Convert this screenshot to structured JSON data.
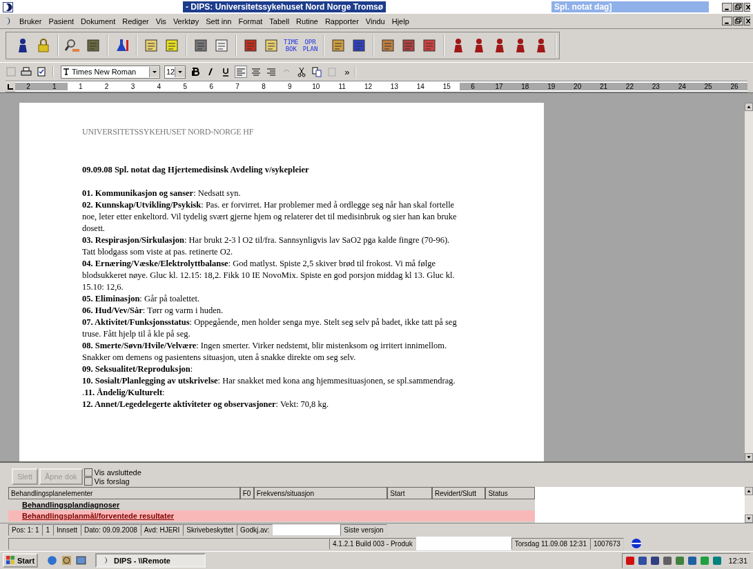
{
  "title_bar": {
    "title": "- DIPS: Universitetssykehuset Nord Norge Tromsø",
    "document_title": "Spl. notat dag]"
  },
  "menu": [
    "Bruker",
    "Pasient",
    "Dokument",
    "Rediger",
    "Vis",
    "Verktøy",
    "Sett inn",
    "Format",
    "Tabell",
    "Rutine",
    "Rapporter",
    "Vindu",
    "Hjelp"
  ],
  "toolbar": {
    "text_buttons": [
      {
        "lines": [
          "TIME",
          "BOK"
        ]
      },
      {
        "lines": [
          "OPR",
          "PLAN"
        ]
      }
    ]
  },
  "format_bar": {
    "font": "Times New Roman",
    "size": "12",
    "more": "»"
  },
  "ruler": {
    "labels": [
      "2",
      "1",
      "1",
      "2",
      "3",
      "4",
      "5",
      "6",
      "7",
      "8",
      "9",
      "10",
      "11",
      "12",
      "13",
      "14",
      "15",
      "6",
      "17",
      "18",
      "19",
      "20",
      "21",
      "22",
      "23",
      "24",
      "25",
      "26"
    ]
  },
  "document": {
    "header": "UNIVERSITETSSYKEHUSET NORD-NORGE HF",
    "title": "09.09.08 Spl. notat dag Hjertemedisinsk Avdeling v/sykepleier",
    "paragraphs": [
      "**01. Kommunikasjon og sanser**: Nedsatt syn.",
      "**02. Kunnskap/Utvikling/Psykisk**: Pas. er forvirret. Har problemer med å ordlegge seg når han skal fortelle noe, leter etter enkeltord. Vil tydelig svært gjerne hjem og relaterer det til medisinbruk og sier han kan bruke dosett.",
      "**03. Respirasjon/Sirkulasjon**: Har brukt 2-3 l O2 til/fra. Sannsynligvis lav SaO2 pga kalde fingre (70-96). Tatt blodgass som viste at pas. retinerte O2.",
      "**04. Ernæring/Væske/Elektrolyttbalanse**: God matlyst. Spiste 2,5 skiver brød til frokost. Vi må følge blodsukkeret nøye. Gluc kl. 12.15: 18,2. Fikk 10 IE NovoMix. Spiste en god porsjon middag kl 13. Gluc kl. 15.10: 12,6.",
      "**05. Eliminasjon**: Går på toalettet.",
      "**06. Hud/Vev/Sår**: Tørr og varm i huden.",
      "**07. Aktivitet/Funksjonsstatus**: Oppegående, men holder senga mye. Stelt seg selv på badet, ikke tatt på seg truse. Fått hjelp til å kle på seg.",
      "**08. Smerte/Søvn/Hvile/Velvære**: Ingen smerter. Virker nedstemt, blir mistenksom og irritert innimellom. Snakker om demens og pasientens situasjon, uten å snakke direkte om seg selv.",
      "**09. Seksualitet/Reproduksjon**:",
      "**10. Sosialt/Planlegging av utskrivelse**: Har snakket med kona ang hjemmesituasjonen, se spl.sammendrag.",
      ".**11. Åndelig/Kulturelt**:",
      "**12. Annet/Legedelegerte aktiviteter og observasjoner**: Vekt: 70,8 kg."
    ]
  },
  "plan_panel": {
    "buttons": [
      {
        "label": "Slett",
        "disabled": true
      },
      {
        "label": "Åpne dok",
        "disabled": true
      }
    ],
    "checkboxes": [
      {
        "label": "Vis avsluttede",
        "checked": false
      },
      {
        "label": "Vis forslag",
        "checked": false
      }
    ],
    "columns": [
      "Behandlingsplanelementer",
      "F0",
      "Frekvens/situasjon",
      "Start",
      "Revidert/Slutt",
      "Status"
    ],
    "rows": [
      {
        "label": "Behandlingsplandiagnoser",
        "selected": false
      },
      {
        "label": "Behandlingsplanmål/forventede resultater",
        "selected": true
      }
    ]
  },
  "status_bar": {
    "row1": [
      {
        "kind": "text",
        "text": "Pos: 1: 1"
      },
      {
        "kind": "text",
        "text": "1"
      },
      {
        "kind": "text",
        "text": "Innsett"
      },
      {
        "kind": "text",
        "text": "Dato: 09.09.2008"
      },
      {
        "kind": "text",
        "text": "Avd: HJERI"
      },
      {
        "kind": "text",
        "text": "Skrivebeskyttet"
      },
      {
        "kind": "text",
        "text": "Godkj.av:"
      },
      {
        "kind": "blank"
      },
      {
        "kind": "text",
        "text": "Siste versjon"
      }
    ],
    "row2": [
      {
        "kind": "text",
        "text": "4.1.2.1 Build 003 - Produk"
      },
      {
        "kind": "blank"
      },
      {
        "kind": "text",
        "text": "Torsdag 11.09.08 12:31"
      },
      {
        "kind": "text",
        "text": "1007673"
      }
    ]
  },
  "taskbar": {
    "start": "Start",
    "tasks": [
      {
        "label": "DIPS - \\\\Remote",
        "selected": true
      }
    ],
    "clock": "12:31"
  }
}
